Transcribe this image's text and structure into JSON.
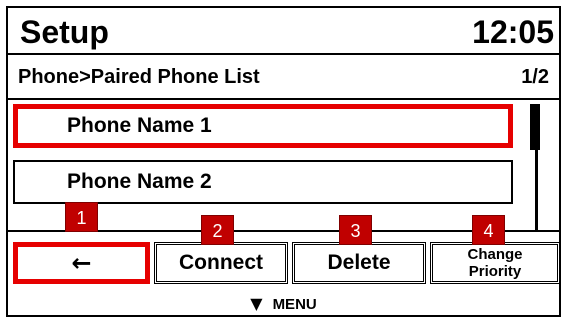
{
  "header": {
    "title": "Setup",
    "clock": "12:05"
  },
  "breadcrumb": {
    "path": "Phone>Paired Phone List",
    "page": "1/2"
  },
  "phones": [
    {
      "name": "Phone Name 1"
    },
    {
      "name": "Phone Name 2"
    }
  ],
  "softkeys": {
    "back": {
      "icon": "left-arrow-icon",
      "glyph": "←"
    },
    "connect": "Connect",
    "delete": "Delete",
    "change_priority_line1": "Change",
    "change_priority_line2": "Priority"
  },
  "badges": [
    "1",
    "2",
    "3",
    "4"
  ],
  "menu": {
    "icon": "down-triangle-icon",
    "glyph": "▼",
    "label": "MENU"
  },
  "colors": {
    "highlight": "#e60000",
    "badge": "#c00000"
  }
}
